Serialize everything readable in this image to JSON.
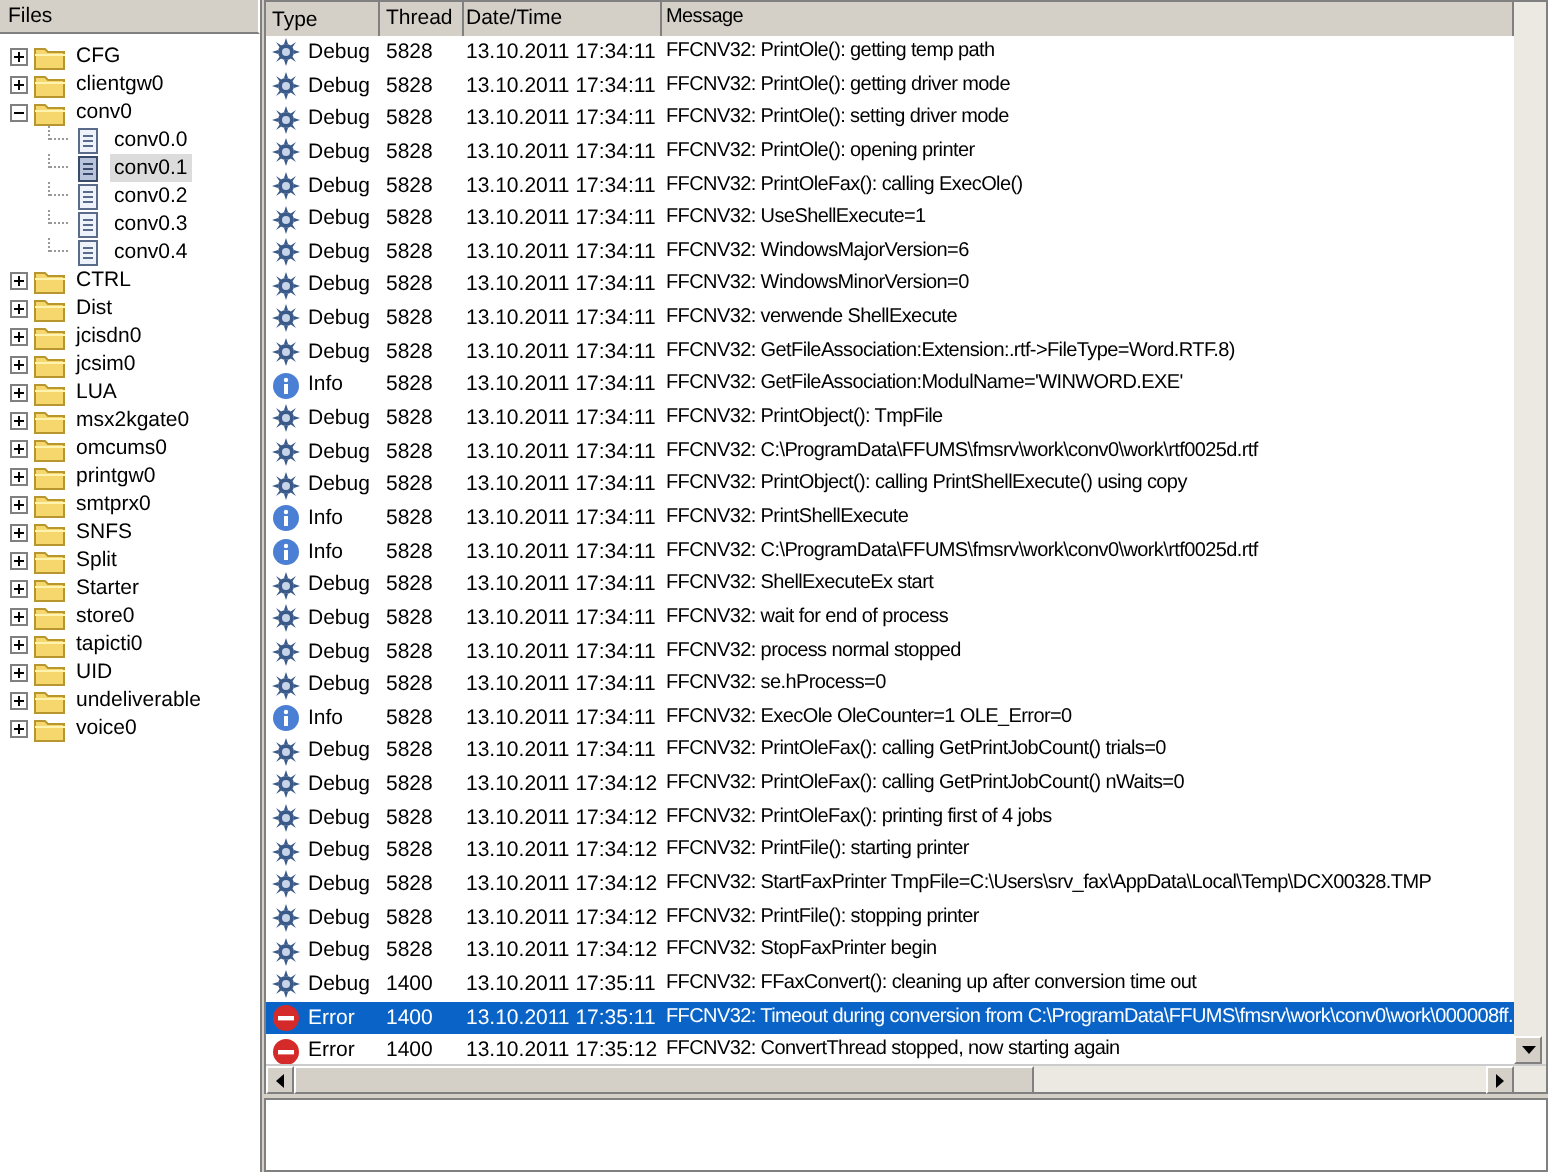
{
  "files_panel": {
    "header": "Files",
    "tree": [
      {
        "label": "CFG",
        "expanded": false,
        "selected": false
      },
      {
        "label": "clientgw0",
        "expanded": false,
        "selected": false
      },
      {
        "label": "conv0",
        "expanded": true,
        "selected": false,
        "children": [
          {
            "label": "conv0.0",
            "selected": false
          },
          {
            "label": "conv0.1",
            "selected": true
          },
          {
            "label": "conv0.2",
            "selected": false
          },
          {
            "label": "conv0.3",
            "selected": false
          },
          {
            "label": "conv0.4",
            "selected": false
          }
        ]
      },
      {
        "label": "CTRL",
        "expanded": false,
        "selected": false
      },
      {
        "label": "Dist",
        "expanded": false,
        "selected": false
      },
      {
        "label": "jcisdn0",
        "expanded": false,
        "selected": false
      },
      {
        "label": "jcsim0",
        "expanded": false,
        "selected": false
      },
      {
        "label": "LUA",
        "expanded": false,
        "selected": false
      },
      {
        "label": "msx2kgate0",
        "expanded": false,
        "selected": false
      },
      {
        "label": "omcums0",
        "expanded": false,
        "selected": false
      },
      {
        "label": "printgw0",
        "expanded": false,
        "selected": false
      },
      {
        "label": "smtprx0",
        "expanded": false,
        "selected": false
      },
      {
        "label": "SNFS",
        "expanded": false,
        "selected": false
      },
      {
        "label": "Split",
        "expanded": false,
        "selected": false
      },
      {
        "label": "Starter",
        "expanded": false,
        "selected": false
      },
      {
        "label": "store0",
        "expanded": false,
        "selected": false
      },
      {
        "label": "tapicti0",
        "expanded": false,
        "selected": false
      },
      {
        "label": "UID",
        "expanded": false,
        "selected": false
      },
      {
        "label": "undeliverable",
        "expanded": false,
        "selected": false
      },
      {
        "label": "voice0",
        "expanded": false,
        "selected": false
      }
    ]
  },
  "log": {
    "columns": [
      "Type",
      "Thread",
      "Date/Time",
      "Message"
    ],
    "rows": [
      {
        "kind": "debug",
        "type": "Debug",
        "thread": "5828",
        "datetime": "13.10.2011 17:34:11",
        "message": "FFCNV32: PrintOle(): getting temp path",
        "selected": false
      },
      {
        "kind": "debug",
        "type": "Debug",
        "thread": "5828",
        "datetime": "13.10.2011 17:34:11",
        "message": "FFCNV32: PrintOle(): getting driver mode",
        "selected": false
      },
      {
        "kind": "debug",
        "type": "Debug",
        "thread": "5828",
        "datetime": "13.10.2011 17:34:11",
        "message": "FFCNV32: PrintOle(): setting driver mode",
        "selected": false
      },
      {
        "kind": "debug",
        "type": "Debug",
        "thread": "5828",
        "datetime": "13.10.2011 17:34:11",
        "message": "FFCNV32: PrintOle(): opening printer",
        "selected": false
      },
      {
        "kind": "debug",
        "type": "Debug",
        "thread": "5828",
        "datetime": "13.10.2011 17:34:11",
        "message": "FFCNV32: PrintOleFax(): calling ExecOle()",
        "selected": false
      },
      {
        "kind": "debug",
        "type": "Debug",
        "thread": "5828",
        "datetime": "13.10.2011 17:34:11",
        "message": "FFCNV32: UseShellExecute=1",
        "selected": false
      },
      {
        "kind": "debug",
        "type": "Debug",
        "thread": "5828",
        "datetime": "13.10.2011 17:34:11",
        "message": "FFCNV32: WindowsMajorVersion=6",
        "selected": false
      },
      {
        "kind": "debug",
        "type": "Debug",
        "thread": "5828",
        "datetime": "13.10.2011 17:34:11",
        "message": "FFCNV32: WindowsMinorVersion=0",
        "selected": false
      },
      {
        "kind": "debug",
        "type": "Debug",
        "thread": "5828",
        "datetime": "13.10.2011 17:34:11",
        "message": "FFCNV32: verwende ShellExecute",
        "selected": false
      },
      {
        "kind": "debug",
        "type": "Debug",
        "thread": "5828",
        "datetime": "13.10.2011 17:34:11",
        "message": "FFCNV32: GetFileAssociation:Extension:.rtf->FileType=Word.RTF.8)",
        "selected": false
      },
      {
        "kind": "info",
        "type": "Info",
        "thread": "5828",
        "datetime": "13.10.2011 17:34:11",
        "message": "FFCNV32: GetFileAssociation:ModulName='WINWORD.EXE'",
        "selected": false
      },
      {
        "kind": "debug",
        "type": "Debug",
        "thread": "5828",
        "datetime": "13.10.2011 17:34:11",
        "message": "FFCNV32: PrintObject(): TmpFile",
        "selected": false
      },
      {
        "kind": "debug",
        "type": "Debug",
        "thread": "5828",
        "datetime": "13.10.2011 17:34:11",
        "message": "FFCNV32: C:\\ProgramData\\FFUMS\\fmsrv\\work\\conv0\\work\\rtf0025d.rtf",
        "selected": false
      },
      {
        "kind": "debug",
        "type": "Debug",
        "thread": "5828",
        "datetime": "13.10.2011 17:34:11",
        "message": "FFCNV32: PrintObject(): calling PrintShellExecute() using copy",
        "selected": false
      },
      {
        "kind": "info",
        "type": "Info",
        "thread": "5828",
        "datetime": "13.10.2011 17:34:11",
        "message": "FFCNV32: PrintShellExecute",
        "selected": false
      },
      {
        "kind": "info",
        "type": "Info",
        "thread": "5828",
        "datetime": "13.10.2011 17:34:11",
        "message": "FFCNV32: C:\\ProgramData\\FFUMS\\fmsrv\\work\\conv0\\work\\rtf0025d.rtf",
        "selected": false
      },
      {
        "kind": "debug",
        "type": "Debug",
        "thread": "5828",
        "datetime": "13.10.2011 17:34:11",
        "message": "FFCNV32: ShellExecuteEx start",
        "selected": false
      },
      {
        "kind": "debug",
        "type": "Debug",
        "thread": "5828",
        "datetime": "13.10.2011 17:34:11",
        "message": "FFCNV32: wait for end of process",
        "selected": false
      },
      {
        "kind": "debug",
        "type": "Debug",
        "thread": "5828",
        "datetime": "13.10.2011 17:34:11",
        "message": "FFCNV32: process normal stopped",
        "selected": false
      },
      {
        "kind": "debug",
        "type": "Debug",
        "thread": "5828",
        "datetime": "13.10.2011 17:34:11",
        "message": "FFCNV32: se.hProcess=0",
        "selected": false
      },
      {
        "kind": "info",
        "type": "Info",
        "thread": "5828",
        "datetime": "13.10.2011 17:34:11",
        "message": "FFCNV32: ExecOle OleCounter=1 OLE_Error=0",
        "selected": false
      },
      {
        "kind": "debug",
        "type": "Debug",
        "thread": "5828",
        "datetime": "13.10.2011 17:34:11",
        "message": "FFCNV32: PrintOleFax(): calling GetPrintJobCount() trials=0",
        "selected": false
      },
      {
        "kind": "debug",
        "type": "Debug",
        "thread": "5828",
        "datetime": "13.10.2011 17:34:12",
        "message": "FFCNV32: PrintOleFax(): calling GetPrintJobCount() nWaits=0",
        "selected": false
      },
      {
        "kind": "debug",
        "type": "Debug",
        "thread": "5828",
        "datetime": "13.10.2011 17:34:12",
        "message": "FFCNV32: PrintOleFax(): printing first of 4 jobs",
        "selected": false
      },
      {
        "kind": "debug",
        "type": "Debug",
        "thread": "5828",
        "datetime": "13.10.2011 17:34:12",
        "message": "FFCNV32: PrintFile(): starting printer",
        "selected": false
      },
      {
        "kind": "debug",
        "type": "Debug",
        "thread": "5828",
        "datetime": "13.10.2011 17:34:12",
        "message": "FFCNV32: StartFaxPrinter TmpFile=C:\\Users\\srv_fax\\AppData\\Local\\Temp\\DCX00328.TMP",
        "selected": false
      },
      {
        "kind": "debug",
        "type": "Debug",
        "thread": "5828",
        "datetime": "13.10.2011 17:34:12",
        "message": "FFCNV32: PrintFile(): stopping printer",
        "selected": false
      },
      {
        "kind": "debug",
        "type": "Debug",
        "thread": "5828",
        "datetime": "13.10.2011 17:34:12",
        "message": "FFCNV32: StopFaxPrinter begin",
        "selected": false
      },
      {
        "kind": "debug",
        "type": "Debug",
        "thread": "1400",
        "datetime": "13.10.2011 17:35:11",
        "message": "FFCNV32: FFaxConvert(): cleaning up after conversion time out",
        "selected": false
      },
      {
        "kind": "error",
        "type": "Error",
        "thread": "1400",
        "datetime": "13.10.2011 17:35:11",
        "message": "FFCNV32: Timeout during conversion from C:\\ProgramData\\FFUMS\\fmsrv\\work\\conv0\\work\\000008ff.",
        "selected": true
      },
      {
        "kind": "error",
        "type": "Error",
        "thread": "1400",
        "datetime": "13.10.2011 17:35:12",
        "message": "FFCNV32: ConvertThread stopped, now starting again",
        "selected": false
      }
    ]
  }
}
